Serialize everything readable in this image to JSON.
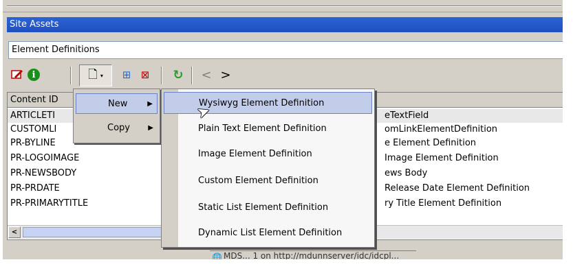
{
  "panel": {
    "title": "Site Assets",
    "combo_value": "Element Definitions"
  },
  "toolbar": {
    "icons": [
      "edit-icon",
      "info-icon",
      "new-document-icon",
      "dropdown-arrow-icon",
      "add-icon",
      "delete-icon",
      "refresh-icon",
      "back-icon",
      "forward-icon"
    ],
    "info_glyph": "i",
    "new_glyph": "🗋",
    "arrow_glyph": "▾",
    "add_glyph": "⊞",
    "delete_glyph": "⊠",
    "refresh_glyph": "↻",
    "prev_glyph": "<",
    "next_glyph": ">"
  },
  "table": {
    "column_header": "Content ID",
    "rows": [
      {
        "id": "ARTICLETI",
        "desc": "eTextField"
      },
      {
        "id": "CUSTOMLI",
        "desc": "omLinkElementDefinition"
      },
      {
        "id": "PR-BYLINE",
        "desc": "e Element Definition"
      },
      {
        "id": "PR-LOGOIMAGE",
        "desc": "Image Element Definition"
      },
      {
        "id": "PR-NEWSBODY",
        "desc": "ews Body"
      },
      {
        "id": "PR-PRDATE",
        "desc": "Release Date Element Definition"
      },
      {
        "id": "PR-PRIMARYTITLE",
        "desc": "ry Title Element Definition"
      }
    ],
    "scroll_left_glyph": "<"
  },
  "context_menu": {
    "items": [
      {
        "label": "New",
        "arrow": "▶"
      },
      {
        "label": "Copy",
        "arrow": "▶"
      }
    ]
  },
  "new_submenu": {
    "items": [
      "Wysiwyg Element Definition",
      "Plain Text Element Definition",
      "Image Element Definition",
      "Custom Element Definition",
      "Static List Element Definition",
      "Dynamic List Element Definition"
    ],
    "highlighted_index": 0
  },
  "status_bar": {
    "text": "MDS... 1 on http://mdunnserver/idc/idcpl..."
  },
  "colors": {
    "title_bar": "#1f4fc0",
    "highlight": "#c2cdea",
    "face": "#d4d0c8"
  }
}
